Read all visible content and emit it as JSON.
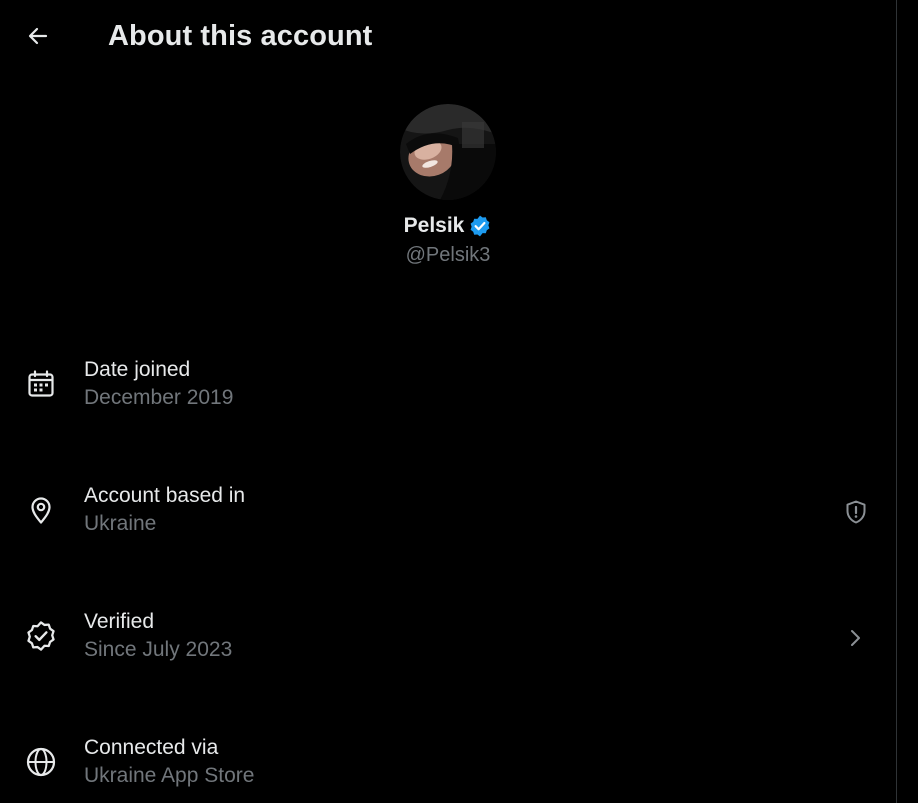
{
  "header": {
    "title": "About this account",
    "back_icon": "arrow-left-icon"
  },
  "profile": {
    "display_name": "Pelsik",
    "handle": "@Pelsik3",
    "verified_badge_color": "#1d9bf0"
  },
  "rows": [
    {
      "icon": "calendar-icon",
      "label": "Date joined",
      "value": "December 2019"
    },
    {
      "icon": "location-pin-icon",
      "label": "Account based in",
      "value": "Ukraine",
      "trailing_icon": "shield-alert-icon"
    },
    {
      "icon": "verified-check-icon",
      "label": "Verified",
      "value": "Since July 2023",
      "trailing_icon": "chevron-right-icon"
    },
    {
      "icon": "globe-icon",
      "label": "Connected via",
      "value": "Ukraine App Store"
    }
  ],
  "colors": {
    "background": "#000000",
    "primary_text": "#e7e9ea",
    "secondary_text": "#71767b",
    "accent": "#1d9bf0"
  }
}
